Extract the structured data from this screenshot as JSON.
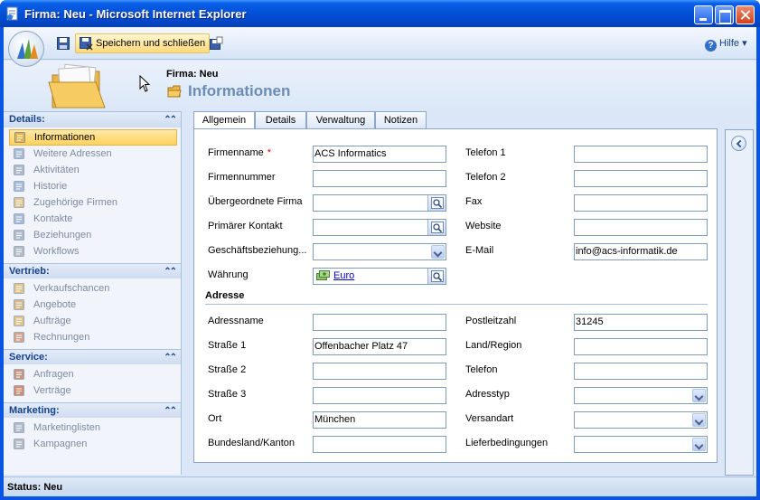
{
  "window": {
    "title": "Firma: Neu - Microsoft Internet Explorer"
  },
  "toolbar": {
    "save_close_label": "Speichern und schließen",
    "help_label": "Hilfe",
    "help_arrow": "▾"
  },
  "header": {
    "entity_type": "Firma: Neu",
    "page_title": "Informationen"
  },
  "nav": {
    "collapse_glyph": "⌃⌃",
    "groups": [
      {
        "title": "Details:",
        "items": [
          {
            "label": "Informationen",
            "icon": "info-page-icon",
            "active": true
          },
          {
            "label": "Weitere Adressen",
            "icon": "address-card-icon"
          },
          {
            "label": "Aktivitäten",
            "icon": "activities-icon"
          },
          {
            "label": "Historie",
            "icon": "history-clock-icon"
          },
          {
            "label": "Zugehörige Firmen",
            "icon": "related-accounts-icon"
          },
          {
            "label": "Kontakte",
            "icon": "contacts-icon"
          },
          {
            "label": "Beziehungen",
            "icon": "relationships-icon"
          },
          {
            "label": "Workflows",
            "icon": "workflow-gear-icon"
          }
        ]
      },
      {
        "title": "Vertrieb:",
        "items": [
          {
            "label": "Verkaufschancen",
            "icon": "opportunity-icon"
          },
          {
            "label": "Angebote",
            "icon": "quote-icon"
          },
          {
            "label": "Aufträge",
            "icon": "order-icon"
          },
          {
            "label": "Rechnungen",
            "icon": "invoice-icon"
          }
        ]
      },
      {
        "title": "Service:",
        "items": [
          {
            "label": "Anfragen",
            "icon": "case-briefcase-icon"
          },
          {
            "label": "Verträge",
            "icon": "contract-icon"
          }
        ]
      },
      {
        "title": "Marketing:",
        "items": [
          {
            "label": "Marketinglisten",
            "icon": "marketing-list-icon"
          },
          {
            "label": "Kampagnen",
            "icon": "campaign-icon"
          }
        ]
      }
    ]
  },
  "tabs": [
    "Allgemein",
    "Details",
    "Verwaltung",
    "Notizen"
  ],
  "form": {
    "required_marker": "*",
    "left": {
      "firmenname": {
        "label": "Firmenname",
        "value": "ACS Informatics"
      },
      "firmennummer": {
        "label": "Firmennummer",
        "value": ""
      },
      "uebergeordnete": {
        "label": "Übergeordnete Firma",
        "value": ""
      },
      "primaerer_kontakt": {
        "label": "Primärer Kontakt",
        "value": ""
      },
      "geschaeftsbeziehung": {
        "label": "Geschäftsbeziehung...",
        "value": ""
      },
      "waehrung": {
        "label": "Währung",
        "value": "Euro"
      }
    },
    "right": {
      "telefon1": {
        "label": "Telefon 1",
        "value": ""
      },
      "telefon2": {
        "label": "Telefon 2",
        "value": ""
      },
      "fax": {
        "label": "Fax",
        "value": ""
      },
      "website": {
        "label": "Website",
        "value": ""
      },
      "email": {
        "label": "E-Mail",
        "value": "info@acs-informatik.de"
      }
    },
    "address_section_title": "Adresse",
    "address_left": {
      "adressname": {
        "label": "Adressname",
        "value": ""
      },
      "strasse1": {
        "label": "Straße 1",
        "value": "Offenbacher Platz 47"
      },
      "strasse2": {
        "label": "Straße 2",
        "value": ""
      },
      "strasse3": {
        "label": "Straße 3",
        "value": ""
      },
      "ort": {
        "label": "Ort",
        "value": "München"
      },
      "bundesland": {
        "label": "Bundesland/Kanton",
        "value": ""
      }
    },
    "address_right": {
      "plz": {
        "label": "Postleitzahl",
        "value": "31245"
      },
      "land": {
        "label": "Land/Region",
        "value": ""
      },
      "telefon": {
        "label": "Telefon",
        "value": ""
      },
      "adresstyp": {
        "label": "Adresstyp",
        "value": ""
      },
      "versandart": {
        "label": "Versandart",
        "value": ""
      },
      "lieferbedingungen": {
        "label": "Lieferbedingungen",
        "value": ""
      }
    }
  },
  "status": {
    "text": "Status: Neu"
  },
  "colors": {
    "title_bar": "#0350d6",
    "page_title": "#6b8cb5",
    "nav_header_text": "#15428b",
    "active_item": "#ffd35c",
    "required": "#ee0000"
  }
}
